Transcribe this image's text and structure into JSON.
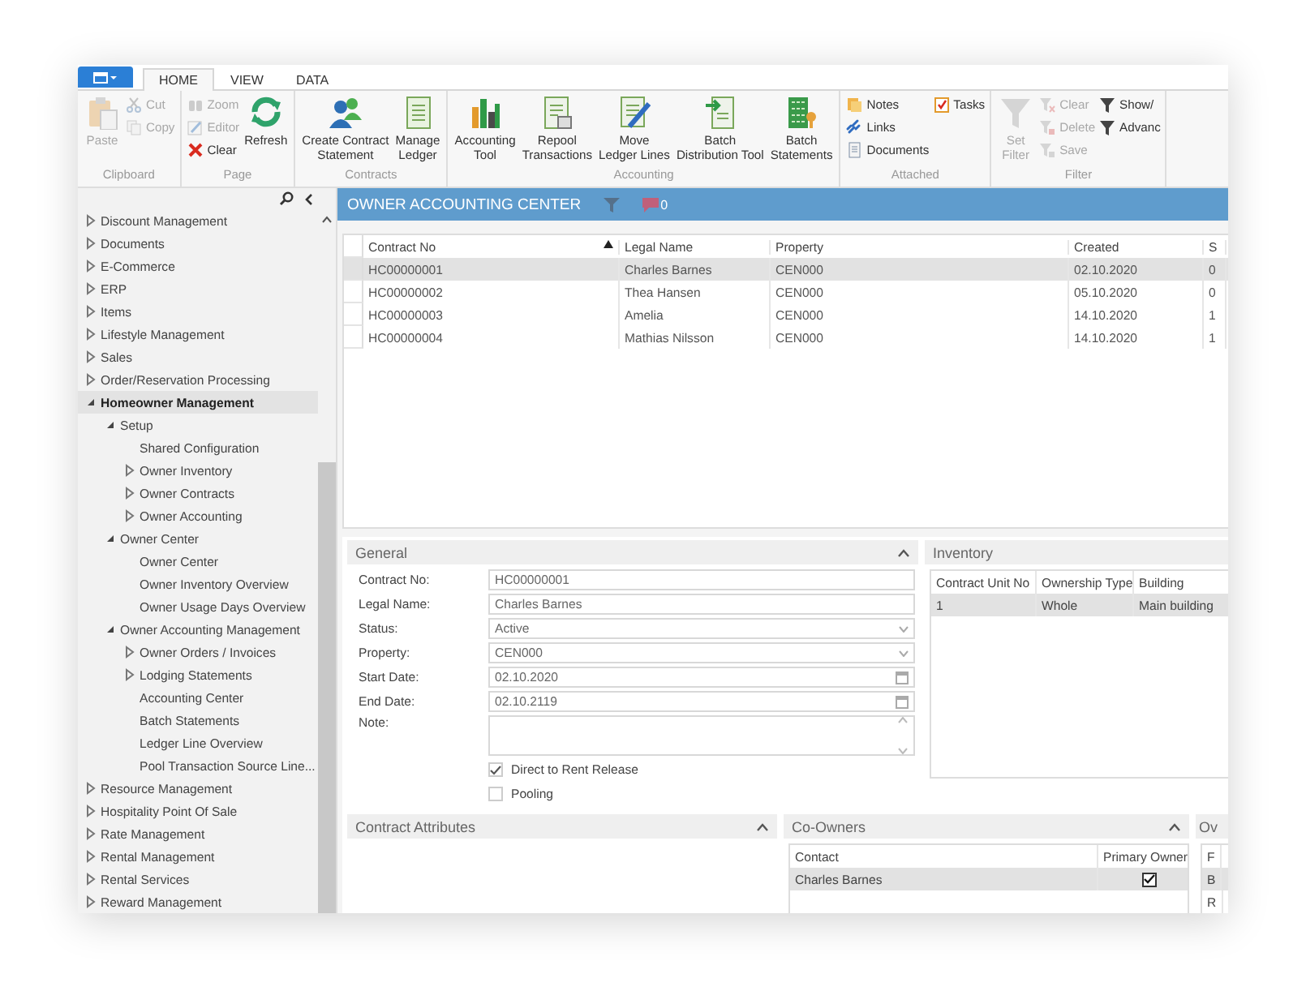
{
  "ribbon": {
    "tabs": [
      {
        "label": "HOME",
        "selected": true
      },
      {
        "label": "VIEW",
        "selected": false
      },
      {
        "label": "DATA",
        "selected": false
      }
    ],
    "groups": [
      {
        "label": "Clipboard",
        "columns": [
          [
            {
              "label": "Paste",
              "kind": "large",
              "disabled": true
            }
          ],
          [
            {
              "label": "Cut",
              "kind": "small",
              "disabled": true
            },
            {
              "label": "Copy",
              "kind": "small",
              "disabled": true
            }
          ]
        ]
      },
      {
        "label": "Page",
        "columns": [
          [
            {
              "label": "Zoom",
              "kind": "small",
              "disabled": true
            },
            {
              "label": "Editor",
              "kind": "small",
              "disabled": true
            },
            {
              "label": "Clear",
              "kind": "small",
              "disabled": false
            }
          ],
          [
            {
              "label": "Refresh",
              "kind": "large",
              "disabled": false
            }
          ]
        ]
      },
      {
        "label": "Contracts",
        "columns": [
          [
            {
              "label": "Create Contract\nStatement",
              "kind": "large",
              "disabled": false
            }
          ],
          [
            {
              "label": "Manage\nLedger",
              "kind": "large",
              "disabled": false
            }
          ]
        ]
      },
      {
        "label": "Accounting",
        "columns": [
          [
            {
              "label": "Accounting\nTool",
              "kind": "large",
              "disabled": false
            }
          ],
          [
            {
              "label": "Repool\nTransactions",
              "kind": "large",
              "disabled": false
            }
          ],
          [
            {
              "label": "Move\nLedger Lines",
              "kind": "large",
              "disabled": false
            }
          ],
          [
            {
              "label": "Batch\nDistribution Tool",
              "kind": "large",
              "disabled": false
            }
          ],
          [
            {
              "label": "Batch\nStatements",
              "kind": "large",
              "disabled": false
            }
          ]
        ]
      },
      {
        "label": "Attached",
        "columns": [
          [
            {
              "label": "Notes",
              "kind": "small",
              "disabled": false
            },
            {
              "label": "Links",
              "kind": "small",
              "disabled": false
            },
            {
              "label": "Documents",
              "kind": "small",
              "disabled": false
            }
          ],
          [
            {
              "label": "Tasks",
              "kind": "small",
              "disabled": false
            }
          ]
        ]
      },
      {
        "label": "Filter",
        "columns": [
          [
            {
              "label": "Set\nFilter",
              "kind": "large",
              "disabled": true
            }
          ],
          [
            {
              "label": "Clear",
              "kind": "small",
              "disabled": true
            },
            {
              "label": "Delete",
              "kind": "small",
              "disabled": true
            },
            {
              "label": "Save",
              "kind": "small",
              "disabled": true
            }
          ],
          [
            {
              "label": "Show/",
              "kind": "small",
              "disabled": false
            },
            {
              "label": "Advanc",
              "kind": "small",
              "disabled": false
            }
          ]
        ]
      }
    ]
  },
  "sidebar": {
    "items": [
      {
        "label": "Discount Management",
        "kind": "folder",
        "expanded": false,
        "selected": false
      },
      {
        "label": "Documents",
        "kind": "folder",
        "expanded": false,
        "selected": false
      },
      {
        "label": "E-Commerce",
        "kind": "folder",
        "expanded": false,
        "selected": false
      },
      {
        "label": "ERP",
        "kind": "folder",
        "expanded": false,
        "selected": false
      },
      {
        "label": "Items",
        "kind": "folder",
        "expanded": false,
        "selected": false
      },
      {
        "label": "Lifestyle Management",
        "kind": "folder",
        "expanded": false,
        "selected": false
      },
      {
        "label": "Sales",
        "kind": "folder",
        "expanded": false,
        "selected": false
      },
      {
        "label": "Order/Reservation Processing",
        "kind": "folder",
        "expanded": false,
        "selected": false
      },
      {
        "label": "Homeowner Management",
        "kind": "folder",
        "expanded": true,
        "selected": true,
        "children": [
          {
            "label": "Setup",
            "kind": "folder",
            "expanded": true,
            "selected": false,
            "children": [
              {
                "label": "Shared Configuration",
                "kind": "page",
                "selected": false
              },
              {
                "label": "Owner Inventory",
                "kind": "folder",
                "expanded": false,
                "selected": false
              },
              {
                "label": "Owner Contracts",
                "kind": "folder",
                "expanded": false,
                "selected": false
              },
              {
                "label": "Owner Accounting",
                "kind": "folder",
                "expanded": false,
                "selected": false
              }
            ]
          },
          {
            "label": "Owner Center",
            "kind": "folder",
            "expanded": true,
            "selected": false,
            "children": [
              {
                "label": "Owner Center",
                "kind": "page",
                "selected": false
              },
              {
                "label": "Owner Inventory Overview",
                "kind": "page",
                "selected": false
              },
              {
                "label": "Owner Usage Days Overview",
                "kind": "page",
                "selected": false
              }
            ]
          },
          {
            "label": "Owner Accounting Management",
            "kind": "folder",
            "expanded": true,
            "selected": false,
            "children": [
              {
                "label": "Owner Orders / Invoices",
                "kind": "folder",
                "expanded": false,
                "selected": false
              },
              {
                "label": "Lodging Statements",
                "kind": "folder",
                "expanded": false,
                "selected": false
              },
              {
                "label": "Accounting Center",
                "kind": "page",
                "selected": false
              },
              {
                "label": "Batch Statements",
                "kind": "page",
                "selected": false
              },
              {
                "label": "Ledger Line Overview",
                "kind": "page",
                "selected": false
              },
              {
                "label": "Pool Transaction Source Line...",
                "kind": "page",
                "selected": false
              }
            ]
          }
        ]
      },
      {
        "label": "Resource Management",
        "kind": "folder",
        "expanded": false,
        "selected": false
      },
      {
        "label": "Hospitality Point Of Sale",
        "kind": "folder",
        "expanded": false,
        "selected": false
      },
      {
        "label": "Rate Management",
        "kind": "folder",
        "expanded": false,
        "selected": false
      },
      {
        "label": "Rental Management",
        "kind": "folder",
        "expanded": false,
        "selected": false
      },
      {
        "label": "Rental Services",
        "kind": "folder",
        "expanded": false,
        "selected": false
      },
      {
        "label": "Reward Management",
        "kind": "folder",
        "expanded": false,
        "selected": false
      }
    ]
  },
  "page": {
    "title": "OWNER ACCOUNTING CENTER",
    "comment_count": "0"
  },
  "table": {
    "columns": [
      {
        "label": "Contract No",
        "sorted": true
      },
      {
        "label": "Legal Name",
        "sorted": false
      },
      {
        "label": "Property",
        "sorted": false
      },
      {
        "label": "Created",
        "sorted": false
      },
      {
        "label": "S",
        "sorted": false
      }
    ],
    "rows": [
      {
        "cells": [
          "HC00000001",
          "Charles Barnes",
          "CEN000",
          "02.10.2020",
          "0"
        ],
        "selected": true
      },
      {
        "cells": [
          "HC00000002",
          "Thea Hansen",
          "CEN000",
          "05.10.2020",
          "0"
        ],
        "selected": false
      },
      {
        "cells": [
          "HC00000003",
          "Amelia",
          "CEN000",
          "14.10.2020",
          "1"
        ],
        "selected": false
      },
      {
        "cells": [
          "HC00000004",
          "Mathias Nilsson",
          "CEN000",
          "14.10.2020",
          "1"
        ],
        "selected": false
      }
    ]
  },
  "general": {
    "title": "General",
    "expanded": true,
    "fields": [
      {
        "label": "Contract No:",
        "value": "HC00000001",
        "kind": "text"
      },
      {
        "label": "Legal Name:",
        "value": "Charles Barnes",
        "kind": "text"
      },
      {
        "label": "Status:",
        "value": "Active",
        "kind": "select"
      },
      {
        "label": "Property:",
        "value": "CEN000",
        "kind": "select"
      },
      {
        "label": "Start Date:",
        "value": "02.10.2020",
        "kind": "date"
      },
      {
        "label": "End Date:",
        "value": "02.10.2119",
        "kind": "date"
      },
      {
        "label": "Note:",
        "kind": "memo"
      }
    ],
    "checkboxes": [
      {
        "label": "Direct to Rent Release",
        "checked": true
      },
      {
        "label": "Pooling",
        "checked": false
      }
    ]
  },
  "inventory": {
    "title": "Inventory",
    "columns": [
      "Contract Unit No",
      "Ownership Type",
      "Building"
    ],
    "rows": [
      {
        "cells": [
          "1",
          "Whole",
          "Main building"
        ],
        "selected": true
      }
    ]
  },
  "contract_attributes": {
    "title": "Contract Attributes",
    "expanded": true
  },
  "co_owners": {
    "title": "Co-Owners",
    "expanded": true,
    "columns": [
      "Contact",
      "Primary Owner"
    ],
    "rows": [
      {
        "contact": "Charles Barnes",
        "primary_owner": true,
        "selected": true
      }
    ]
  },
  "panel_4": {
    "title": "Ov",
    "columns": [
      "F"
    ],
    "rows": [
      {
        "cells": [
          "B"
        ],
        "selected": true
      },
      {
        "cells": [
          "R"
        ],
        "selected": false
      }
    ]
  }
}
